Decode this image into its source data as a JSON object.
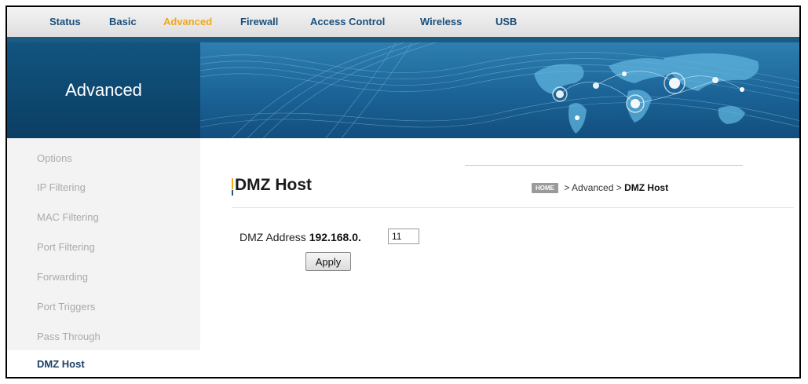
{
  "nav": {
    "items": [
      {
        "label": "Status"
      },
      {
        "label": "Basic"
      },
      {
        "label": "Advanced"
      },
      {
        "label": "Firewall"
      },
      {
        "label": "Access Control"
      },
      {
        "label": "Wireless"
      },
      {
        "label": "USB"
      }
    ],
    "active_label": "Advanced"
  },
  "banner": {
    "section_title": "Advanced"
  },
  "sidebar": {
    "items": [
      {
        "label": "Options"
      },
      {
        "label": "IP Filtering"
      },
      {
        "label": "MAC Filtering"
      },
      {
        "label": "Port Filtering"
      },
      {
        "label": "Forwarding"
      },
      {
        "label": "Port Triggers"
      },
      {
        "label": "Pass Through"
      }
    ],
    "active_item": "DMZ Host"
  },
  "page": {
    "title": "DMZ Host"
  },
  "breadcrumb": {
    "home_badge": "HOME",
    "sep1": " > ",
    "section": "Advanced",
    "sep2": " > ",
    "current": "DMZ Host"
  },
  "form": {
    "label": "DMZ Address",
    "prefix": "192.168.0.",
    "value": "11",
    "apply_label": "Apply"
  },
  "colors": {
    "nav_link": "#1a4f7a",
    "nav_active": "#f0a81c",
    "banner_dark": "#0b3e63",
    "sidebar_bg": "#f3f3f3"
  }
}
